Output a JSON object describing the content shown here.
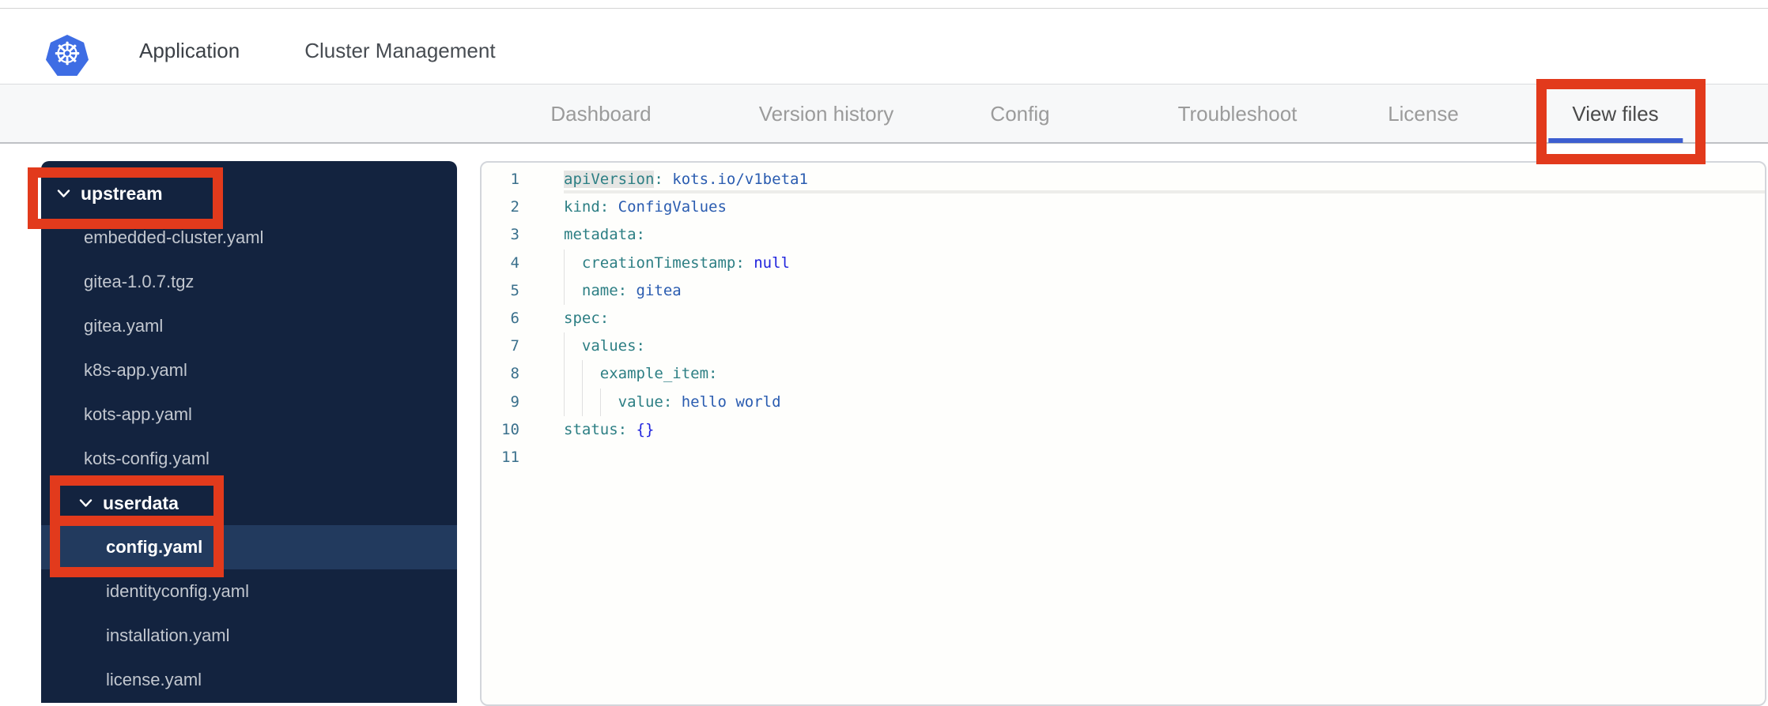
{
  "header": {
    "logo_icon": "kubernetes-helm-wheel",
    "tabs": [
      {
        "label": "Application",
        "active": true
      },
      {
        "label": "Cluster Management",
        "active": false
      }
    ]
  },
  "subnav": {
    "tabs": [
      {
        "label": "Dashboard",
        "active": false
      },
      {
        "label": "Version history",
        "active": false
      },
      {
        "label": "Config",
        "active": false
      },
      {
        "label": "Troubleshoot",
        "active": false
      },
      {
        "label": "License",
        "active": false
      },
      {
        "label": "View files",
        "active": true
      }
    ]
  },
  "sidebar": {
    "items": [
      {
        "label": "upstream",
        "type": "folder",
        "level": 0,
        "expanded": true,
        "selected": false
      },
      {
        "label": "embedded-cluster.yaml",
        "type": "file",
        "level": 1,
        "selected": false
      },
      {
        "label": "gitea-1.0.7.tgz",
        "type": "file",
        "level": 1,
        "selected": false
      },
      {
        "label": "gitea.yaml",
        "type": "file",
        "level": 1,
        "selected": false
      },
      {
        "label": "k8s-app.yaml",
        "type": "file",
        "level": 1,
        "selected": false
      },
      {
        "label": "kots-app.yaml",
        "type": "file",
        "level": 1,
        "selected": false
      },
      {
        "label": "kots-config.yaml",
        "type": "file",
        "level": 1,
        "selected": false
      },
      {
        "label": "userdata",
        "type": "folder",
        "level": 1,
        "expanded": true,
        "selected": false
      },
      {
        "label": "config.yaml",
        "type": "file",
        "level": 2,
        "selected": true
      },
      {
        "label": "identityconfig.yaml",
        "type": "file",
        "level": 2,
        "selected": false
      },
      {
        "label": "installation.yaml",
        "type": "file",
        "level": 2,
        "selected": false
      },
      {
        "label": "license.yaml",
        "type": "file",
        "level": 2,
        "selected": false
      }
    ]
  },
  "editor": {
    "language": "yaml",
    "lines": [
      {
        "num": 1,
        "indent": 0,
        "tokens": [
          {
            "c": "k",
            "t": "apiVersion",
            "hl": true
          },
          {
            "c": "k",
            "t": ":"
          },
          {
            "c": "p",
            "t": " "
          },
          {
            "c": "v",
            "t": "kots.io/v1beta1"
          }
        ]
      },
      {
        "num": 2,
        "indent": 0,
        "tokens": [
          {
            "c": "k",
            "t": "kind:"
          },
          {
            "c": "p",
            "t": " "
          },
          {
            "c": "v",
            "t": "ConfigValues"
          }
        ]
      },
      {
        "num": 3,
        "indent": 0,
        "tokens": [
          {
            "c": "k",
            "t": "metadata:"
          }
        ]
      },
      {
        "num": 4,
        "indent": 1,
        "tokens": [
          {
            "c": "k",
            "t": "creationTimestamp:"
          },
          {
            "c": "p",
            "t": " "
          },
          {
            "c": "a",
            "t": "null"
          }
        ]
      },
      {
        "num": 5,
        "indent": 1,
        "tokens": [
          {
            "c": "k",
            "t": "name:"
          },
          {
            "c": "p",
            "t": " "
          },
          {
            "c": "v",
            "t": "gitea"
          }
        ]
      },
      {
        "num": 6,
        "indent": 0,
        "tokens": [
          {
            "c": "k",
            "t": "spec:"
          }
        ]
      },
      {
        "num": 7,
        "indent": 1,
        "tokens": [
          {
            "c": "k",
            "t": "values:"
          }
        ]
      },
      {
        "num": 8,
        "indent": 2,
        "tokens": [
          {
            "c": "k",
            "t": "example_item:"
          }
        ]
      },
      {
        "num": 9,
        "indent": 3,
        "tokens": [
          {
            "c": "k",
            "t": "value:"
          },
          {
            "c": "p",
            "t": " "
          },
          {
            "c": "v",
            "t": "hello world"
          }
        ]
      },
      {
        "num": 10,
        "indent": 0,
        "tokens": [
          {
            "c": "k",
            "t": "status:"
          },
          {
            "c": "p",
            "t": " "
          },
          {
            "c": "a",
            "t": "{}"
          }
        ]
      },
      {
        "num": 11,
        "indent": 0,
        "tokens": []
      }
    ]
  },
  "annotations": {
    "color": "#e23a1c",
    "targets": [
      "View files",
      "upstream",
      "userdata",
      "config.yaml"
    ]
  },
  "colors": {
    "accent_blue": "#3c6ce0",
    "underline_blue": "#3c5ed0",
    "sidebar_bg": "#13233f",
    "sidebar_selected_bg": "#223a5e",
    "subnav_bg": "#f7f8f9",
    "token_key": "#2d7f84",
    "token_value": "#2a5cb0",
    "token_atom": "#2024dd",
    "annotation_red": "#e23a1c"
  }
}
